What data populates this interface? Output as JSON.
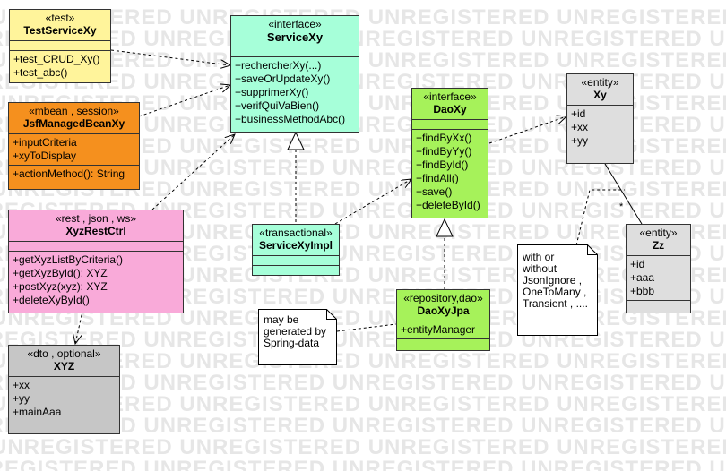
{
  "watermark": "UNREGISTERED UNREGISTERED UNREGISTERED UNREGISTERED UNREGISTERED",
  "colors": {
    "yellow": "#fff49b",
    "orange": "#f5901e",
    "pink": "#f9aad9",
    "gray": "#c6c6c6",
    "mint": "#a6ffd9",
    "green": "#a6f25a",
    "lightgray": "#dedede",
    "note": "#ffffff"
  },
  "classes": {
    "test_service_xy": {
      "stereotype": "«test»",
      "name": "TestServiceXy",
      "attributes": [],
      "operations": [
        "+test_CRUD_Xy()",
        "+test_abc()"
      ]
    },
    "jsf_managed_bean_xy": {
      "stereotype": "«mbean , session»",
      "name": "JsfManagedBeanXy",
      "attributes": [
        "+inputCriteria",
        "+xyToDisplay"
      ],
      "operations": [
        "+actionMethod(): String"
      ]
    },
    "xyz_rest_ctrl": {
      "stereotype": "«rest , json , ws»",
      "name": "XyzRestCtrl",
      "attributes": [],
      "operations": [
        "+getXyzListByCriteria()",
        "+getXyzById(): XYZ",
        "+postXyz(xyz): XYZ",
        "+deleteXyById()"
      ]
    },
    "xyz_dto": {
      "stereotype": "«dto , optional»",
      "name": "XYZ",
      "attributes": [
        "+xx",
        "+yy",
        "+mainAaa"
      ],
      "operations": []
    },
    "service_xy": {
      "stereotype": "«interface»",
      "name": "ServiceXy",
      "attributes": [],
      "operations": [
        "+rechercherXy(...)",
        "+saveOrUpdateXy()",
        "+supprimerXy()",
        "+verifQuiVaBien()",
        "+businessMethodAbc()"
      ]
    },
    "service_xy_impl": {
      "stereotype": "«transactional»",
      "name": "ServiceXyImpl",
      "attributes": [],
      "operations": []
    },
    "dao_xy": {
      "stereotype": "«interface»",
      "name": "DaoXy",
      "attributes": [],
      "operations": [
        "+findByXx()",
        "+findByYy()",
        "+findById()",
        "+findAll()",
        "+save()",
        "+deleteById()"
      ]
    },
    "dao_xy_jpa": {
      "stereotype": "«repository,dao»",
      "name": "DaoXyJpa",
      "attributes": [
        "+entityManager"
      ],
      "operations": []
    },
    "xy_entity": {
      "stereotype": "«entity»",
      "name": "Xy",
      "attributes": [
        "+id",
        "+xx",
        "+yy"
      ],
      "operations": []
    },
    "zz_entity": {
      "stereotype": "«entity»",
      "name": "Zz",
      "attributes": [
        "+id",
        "+aaa",
        "+bbb"
      ],
      "operations": []
    }
  },
  "notes": {
    "spring_data": [
      "may be",
      "generated by",
      "Spring-data"
    ],
    "annotations": [
      "with or",
      "without",
      "JsonIgnore ,",
      "OneToMany ,",
      "Transient , ...."
    ]
  },
  "multiplicity": "*"
}
